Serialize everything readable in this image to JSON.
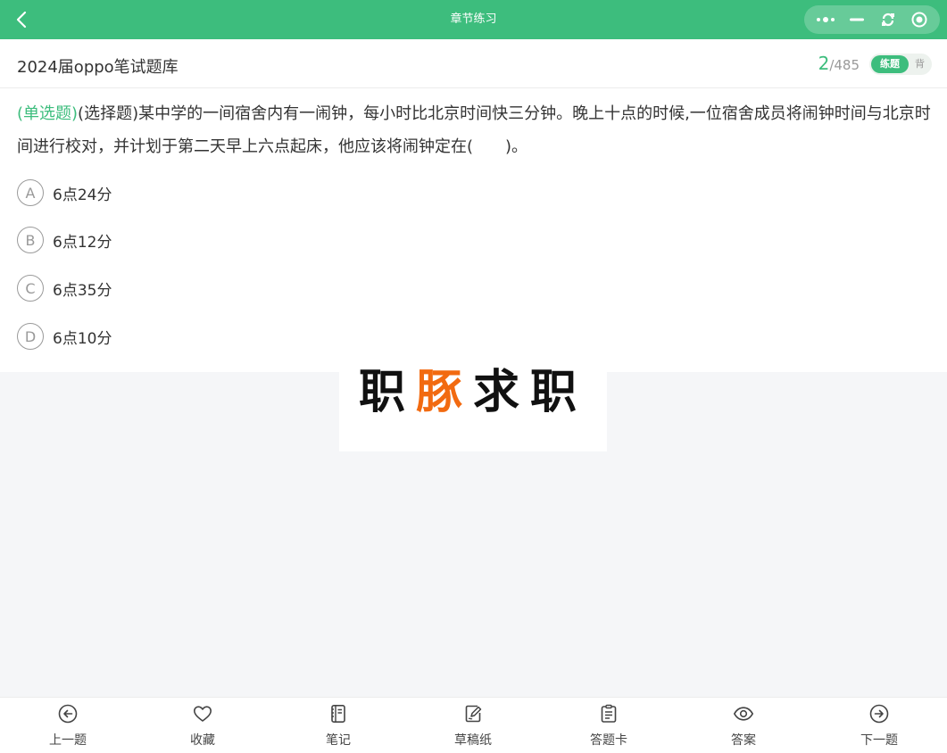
{
  "topbar": {
    "title": "章节练习"
  },
  "header": {
    "bank_title": "2024届oppo笔试题库",
    "current": "2",
    "total": "/485",
    "mode_active": "练题",
    "mode_inactive": "背"
  },
  "question": {
    "type_label": "(单选题)",
    "text": "(选择题)某中学的一间宿舍内有一闹钟，每小时比北京时间快三分钟。晚上十点的时候,一位宿舍成员将闹钟时间与北京时间进行校对，并计划于第二天早上六点起床，他应该将闹钟定在(　　)。"
  },
  "options": [
    {
      "letter": "A",
      "text": "6点24分"
    },
    {
      "letter": "B",
      "text": "6点12分"
    },
    {
      "letter": "C",
      "text": "6点35分"
    },
    {
      "letter": "D",
      "text": "6点10分"
    }
  ],
  "watermark": {
    "part1": "职",
    "part2": "豚",
    "part3": "求职"
  },
  "bottom_tabs": [
    {
      "label": "上一题",
      "icon": "arrow-left-circle-icon"
    },
    {
      "label": "收藏",
      "icon": "heart-icon"
    },
    {
      "label": "笔记",
      "icon": "notebook-icon"
    },
    {
      "label": "草稿纸",
      "icon": "draft-paper-icon"
    },
    {
      "label": "答题卡",
      "icon": "answer-card-icon"
    },
    {
      "label": "答案",
      "icon": "eye-icon"
    },
    {
      "label": "下一题",
      "icon": "arrow-right-circle-icon"
    }
  ],
  "colors": {
    "brand": "#3dbd7d",
    "watermark_accent": "#f26a10"
  }
}
